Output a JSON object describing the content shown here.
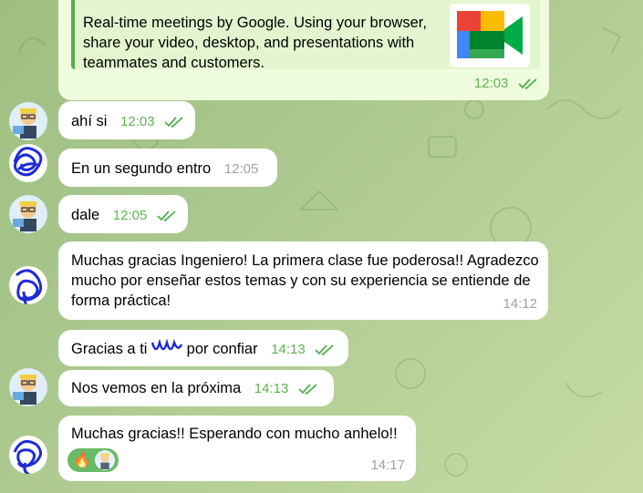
{
  "preview": {
    "text": "Real-time meetings by Google. Using your browser, share your video, desktop, and presentations with teammates and customers.",
    "time": "12:03",
    "logo": "google-meet-logo"
  },
  "messages": [
    {
      "text": "ahí si",
      "time": "12:03",
      "read": true
    },
    {
      "text": "En un segundo entro",
      "time": "12:05"
    },
    {
      "text": "dale",
      "time": "12:05",
      "read": true
    },
    {
      "text": "Muchas gracias Ingeniero! La primera clase fue poderosa!! Agradezco mucho por enseñar estos temas y con su experiencia se entiende de forma práctica!",
      "time": "14:12"
    },
    {
      "text": "Gracias a ti",
      "text2": "por confiar",
      "time": "14:13",
      "read": true
    },
    {
      "text": "Nos vemos en la próxima",
      "time": "14:13",
      "read": true
    },
    {
      "text": "Muchas gracias!! Esperando con mucho anhelo!!",
      "time": "14:17",
      "reaction": "🔥"
    }
  ],
  "colors": {
    "accent": "#4fae4e",
    "bubble_in": "#ffffff",
    "bubble_out": "#effdde",
    "time_out": "#5fb353",
    "scribble": "#1d2bd6"
  }
}
